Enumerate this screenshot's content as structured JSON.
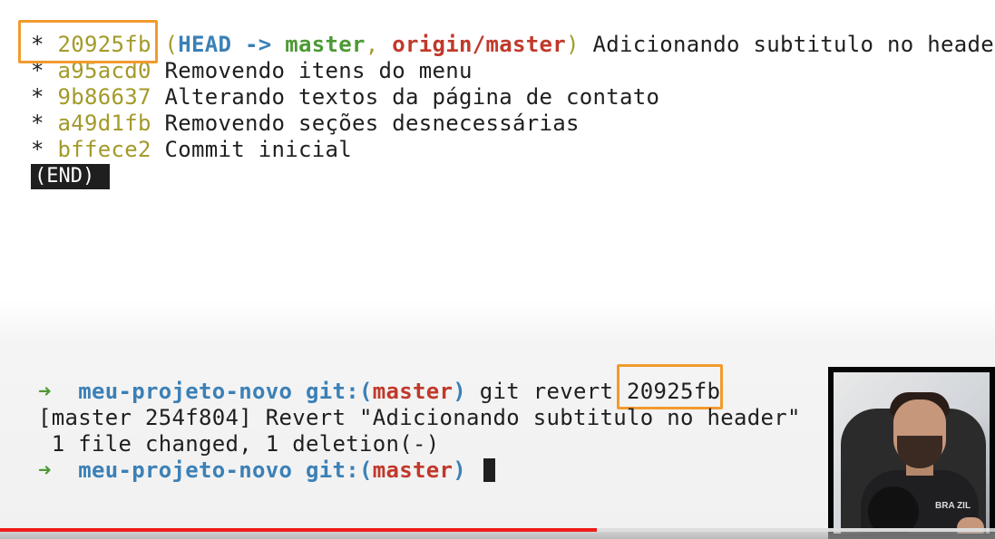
{
  "log": {
    "lines": [
      {
        "bullet": "*",
        "hash": "20925fb",
        "head": "HEAD",
        "arrow": "->",
        "branch": "master",
        "origin": "origin/master",
        "msg": "Adicionando subtitulo no header"
      },
      {
        "bullet": "*",
        "hash": "a95acd0",
        "msg": "Removendo itens do menu"
      },
      {
        "bullet": "*",
        "hash": "9b86637",
        "msg": "Alterando textos da página de contato"
      },
      {
        "bullet": "*",
        "hash": "a49d1fb",
        "msg": "Removendo seções desnecessárias"
      },
      {
        "bullet": "*",
        "hash": "bffece2",
        "msg": "Commit inicial"
      }
    ],
    "end_label": "(END)"
  },
  "shell": {
    "prompt_arrow": "➜",
    "project": "meu-projeto-novo",
    "git_label": "git:",
    "branch": "master",
    "command": "git revert",
    "command_arg": "20925fb",
    "output_line1": "[master 254f804] Revert \"Adicionando subtitulo no header\"",
    "output_line2": " 1 file changed, 1 deletion(-)"
  },
  "webcam": {
    "shirt_text": "BRA ZIL"
  },
  "video": {
    "progress_fraction": 0.6,
    "buffer_fraction": 0.99,
    "progress_color": "#ee1b1b"
  },
  "colors": {
    "highlight": "#f29a2e",
    "hash": "#a39a2a",
    "blue": "#3b80b6",
    "green": "#4d9a35",
    "red": "#c0392b"
  }
}
